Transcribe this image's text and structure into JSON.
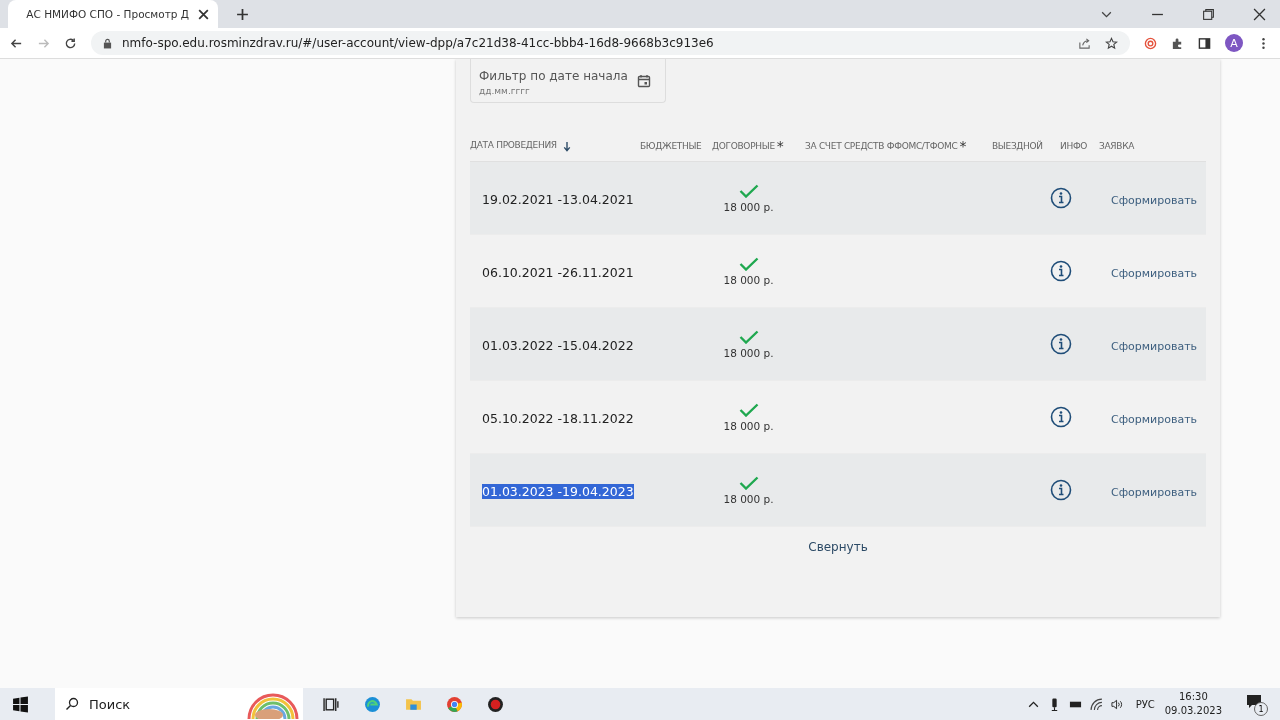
{
  "browser": {
    "tab_title": "АС НМИФО СПО - Просмотр Д",
    "url": "nmfo-spo.edu.rosminzdrav.ru/#/user-account/view-dpp/a7c21d38-41cc-bbb4-16d8-9668b3c913e6",
    "profile_initial": "A"
  },
  "filter": {
    "label": "Фильтр по дате начала",
    "placeholder": "дд.мм.гггг"
  },
  "columns": [
    {
      "label": "ДАТА ПРОВЕДЕНИЯ",
      "sorted": true
    },
    {
      "label": "БЮДЖЕТНЫЕ"
    },
    {
      "label": "ДОГОВОРНЫЕ",
      "note": "*"
    },
    {
      "label": "ЗА СЧЕТ СРЕДСТВ ФФОМС/ТФОМС",
      "note": "*"
    },
    {
      "label": "ВЫЕЗДНОЙ"
    },
    {
      "label": "ИНФО"
    },
    {
      "label": "ЗАЯВКА"
    }
  ],
  "rows": [
    {
      "date": "19.02.2021 -13.04.2021",
      "contract": true,
      "price": "18 000 р.",
      "action": "Сформировать",
      "text_selected": false
    },
    {
      "date": "06.10.2021 -26.11.2021",
      "contract": true,
      "price": "18 000 р.",
      "action": "Сформировать",
      "text_selected": false
    },
    {
      "date": "01.03.2022 -15.04.2022",
      "contract": true,
      "price": "18 000 р.",
      "action": "Сформировать",
      "text_selected": false
    },
    {
      "date": "05.10.2022 -18.11.2022",
      "contract": true,
      "price": "18 000 р.",
      "action": "Сформировать",
      "text_selected": false
    },
    {
      "date": "01.03.2023 -19.04.2023",
      "contract": true,
      "price": "18 000 р.",
      "action": "Сформировать",
      "text_selected": true
    }
  ],
  "collapse": "Свернуть",
  "taskbar": {
    "search_placeholder": "Поиск",
    "language": "РУС",
    "time": "16:30",
    "date": "09.03.2023",
    "notifications": "1"
  }
}
